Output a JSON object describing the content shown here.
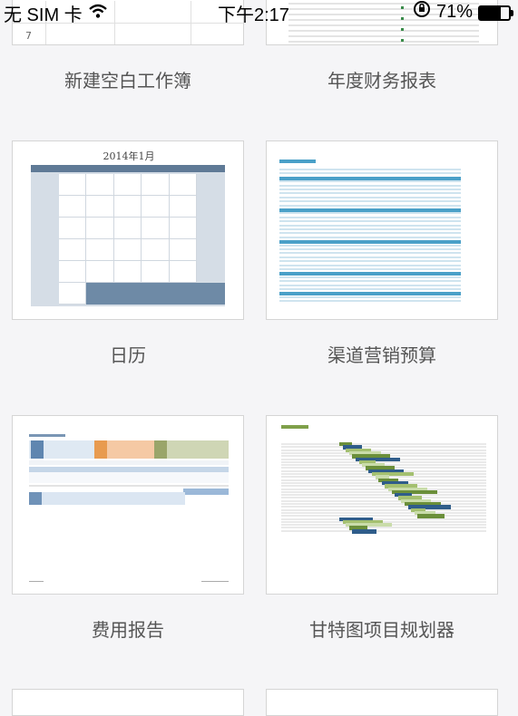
{
  "status": {
    "carrier": "无 SIM 卡",
    "time": "下午2:17",
    "battery": "71%",
    "battery_level": 0.71
  },
  "templates": [
    {
      "label": "新建空白工作簿",
      "row_number": "7"
    },
    {
      "label": "年度财务报表"
    },
    {
      "label": "日历",
      "calendar_title": "2014年1月"
    },
    {
      "label": "渠道营销预算"
    },
    {
      "label": "费用报告"
    },
    {
      "label": "甘特图项目规划器"
    }
  ]
}
